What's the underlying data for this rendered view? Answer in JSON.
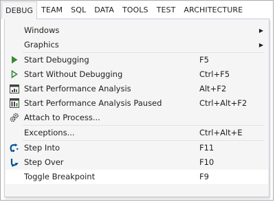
{
  "menubar": {
    "items": [
      {
        "label": "DEBUG",
        "active": true
      },
      {
        "label": "TEAM"
      },
      {
        "label": "SQL"
      },
      {
        "label": "DATA"
      },
      {
        "label": "TOOLS"
      },
      {
        "label": "TEST"
      },
      {
        "label": "ARCHITECTURE"
      }
    ]
  },
  "debug_menu": {
    "windows": {
      "label": "Windows"
    },
    "graphics": {
      "label": "Graphics"
    },
    "start_debugging": {
      "label": "Start Debugging",
      "shortcut": "F5",
      "icon": "play-filled-icon"
    },
    "start_without_debugging": {
      "label": "Start Without Debugging",
      "shortcut": "Ctrl+F5",
      "icon": "play-outline-icon"
    },
    "start_performance_analysis": {
      "label": "Start Performance Analysis",
      "shortcut": "Alt+F2",
      "icon": "performance-chart-icon"
    },
    "start_performance_analysis_paused": {
      "label": "Start Performance Analysis Paused",
      "shortcut": "Ctrl+Alt+F2",
      "icon": "performance-paused-icon"
    },
    "attach_to_process": {
      "label": "Attach to Process...",
      "icon": "attach-gears-icon"
    },
    "exceptions": {
      "label": "Exceptions...",
      "shortcut": "Ctrl+Alt+E"
    },
    "step_into": {
      "label": "Step Into",
      "shortcut": "F11",
      "icon": "step-into-icon"
    },
    "step_over": {
      "label": "Step Over",
      "shortcut": "F10",
      "icon": "step-over-icon"
    },
    "toggle_breakpoint": {
      "label": "Toggle Breakpoint",
      "shortcut": "F9"
    }
  },
  "colors": {
    "play_green": "#388a34",
    "step_blue": "#00529b",
    "menu_bg": "#f5f5f5",
    "highlight_bg": "#ffffff"
  }
}
